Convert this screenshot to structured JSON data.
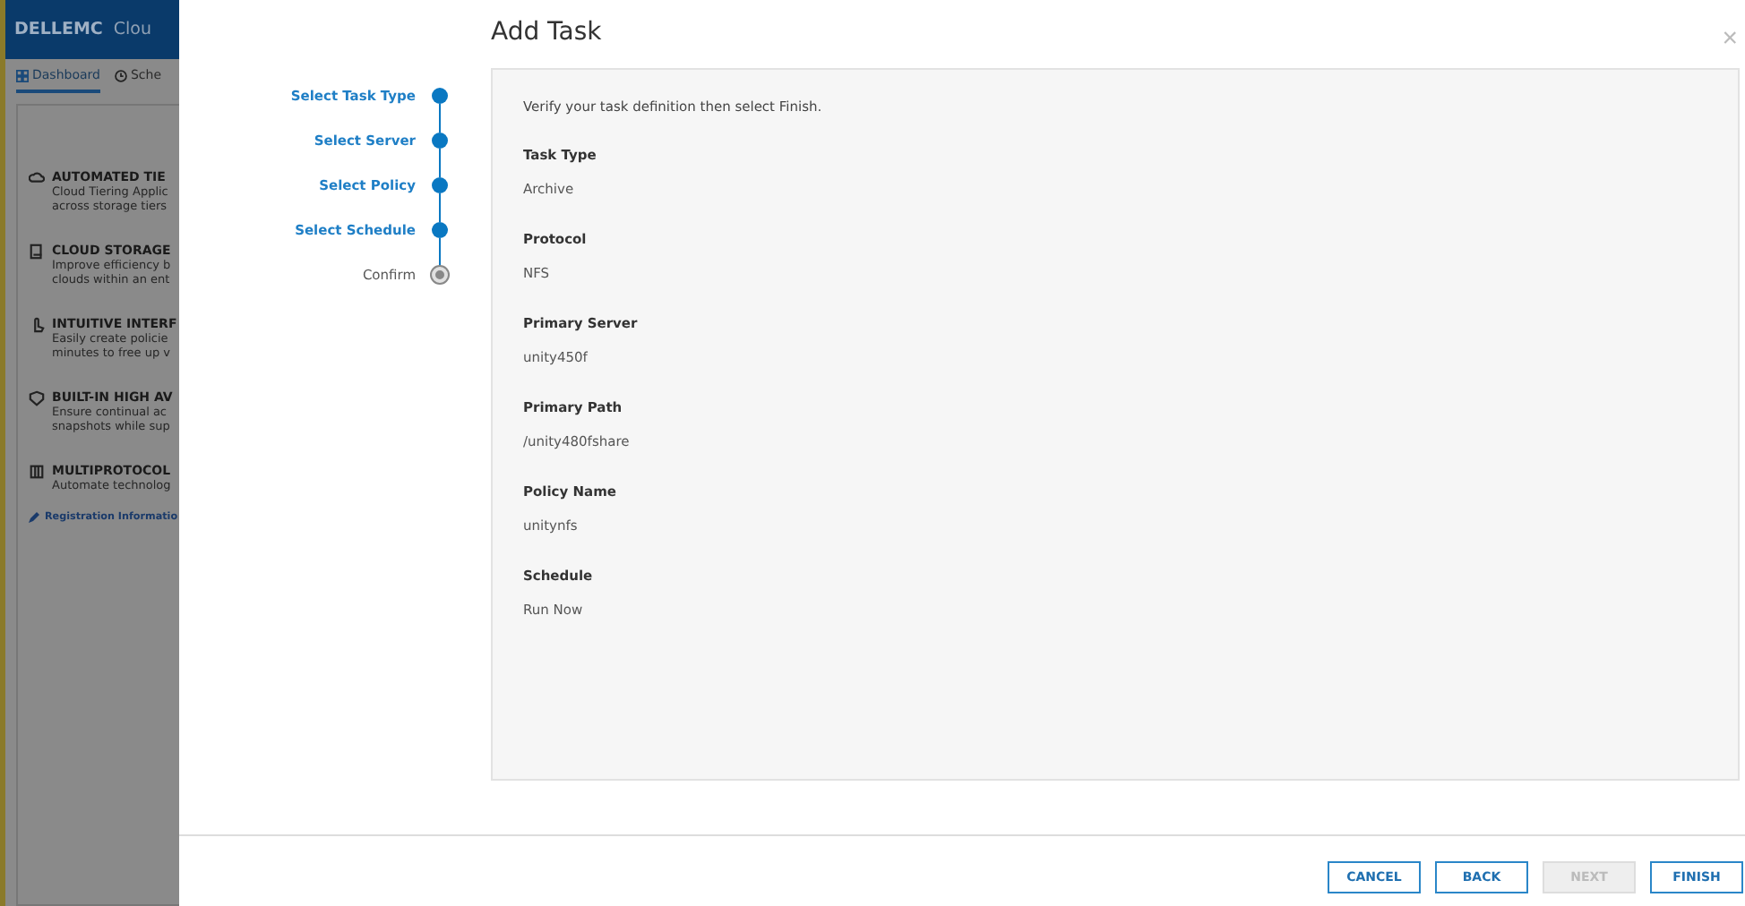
{
  "background_app": {
    "logo": "DELLEMC",
    "title": "Clou",
    "tabs": [
      {
        "label": "Dashboard",
        "selected": true
      },
      {
        "label": "Sche",
        "selected": false
      }
    ],
    "features": [
      {
        "title": "AUTOMATED TIE",
        "lines": [
          "Cloud Tiering Applic",
          "across storage tiers"
        ]
      },
      {
        "title": "CLOUD STORAGE",
        "lines": [
          "Improve efficiency b",
          "clouds within an ent"
        ]
      },
      {
        "title": "INTUITIVE INTERF",
        "lines": [
          "Easily create policie",
          "minutes to free up v"
        ]
      },
      {
        "title": "BUILT-IN HIGH AV",
        "lines": [
          "Ensure continual ac",
          "snapshots while sup"
        ]
      },
      {
        "title": "MULTIPROTOCOL",
        "lines": [
          "Automate technolog"
        ]
      }
    ],
    "link": "Registration Informatio"
  },
  "dialog": {
    "title": "Add Task",
    "close": "×",
    "steps": [
      {
        "label": "Select Task Type",
        "done": true
      },
      {
        "label": "Select Server",
        "done": true
      },
      {
        "label": "Select Policy",
        "done": true
      },
      {
        "label": "Select Schedule",
        "done": true
      },
      {
        "label": "Confirm",
        "done": false
      }
    ],
    "instruction": "Verify your task definition then select Finish.",
    "fields": [
      {
        "label": "Task Type",
        "value": "Archive"
      },
      {
        "label": "Protocol",
        "value": "NFS"
      },
      {
        "label": "Primary Server",
        "value": "unity450f"
      },
      {
        "label": "Primary Path",
        "value": "/unity480fshare"
      },
      {
        "label": "Policy Name",
        "value": "unitynfs"
      },
      {
        "label": "Schedule",
        "value": "Run Now"
      }
    ],
    "buttons": [
      {
        "label": "CANCEL",
        "disabled": false
      },
      {
        "label": "BACK",
        "disabled": false
      },
      {
        "label": "NEXT",
        "disabled": true
      },
      {
        "label": "FINISH",
        "disabled": false
      }
    ]
  }
}
